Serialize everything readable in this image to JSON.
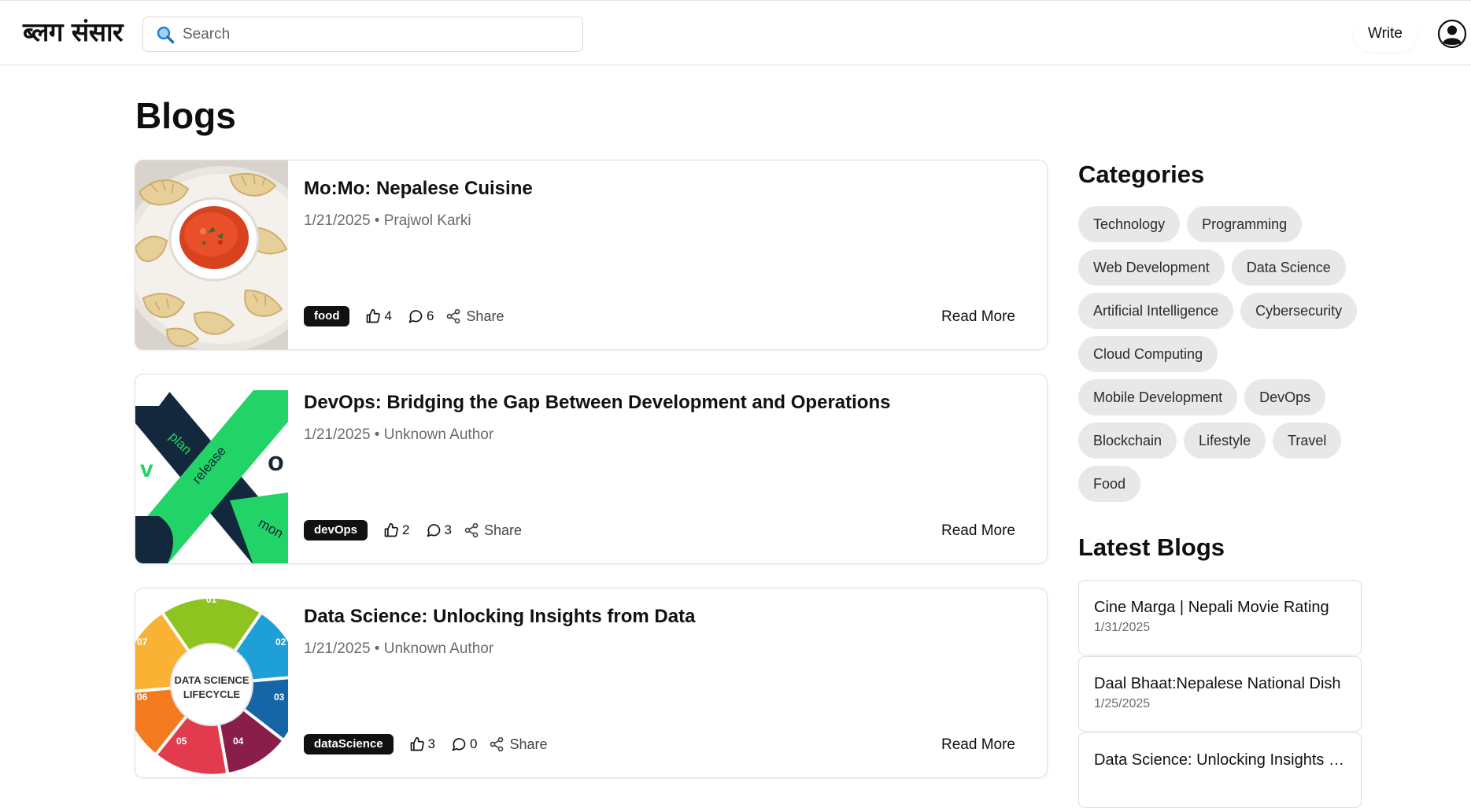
{
  "header": {
    "logo": "ब्लग संसार",
    "search_placeholder": "Search",
    "write_label": "Write"
  },
  "main": {
    "title": "Blogs",
    "posts": [
      {
        "title": "Mo:Mo: Nepalese Cuisine",
        "meta": "1/21/2025 • Prajwol Karki",
        "tag": "food",
        "likes": "4",
        "comments": "6",
        "share_label": "Share",
        "read_more": "Read More"
      },
      {
        "title": "DevOps: Bridging the Gap Between Development and Operations",
        "meta": "1/21/2025 • Unknown Author",
        "tag": "devOps",
        "likes": "2",
        "comments": "3",
        "share_label": "Share",
        "read_more": "Read More",
        "image_text": {
          "left": "v",
          "plan": "plan",
          "release": "release",
          "right": "o",
          "mon": "mon"
        }
      },
      {
        "title": "Data Science: Unlocking Insights from Data",
        "meta": "1/21/2025 • Unknown Author",
        "tag": "dataScience",
        "likes": "3",
        "comments": "0",
        "share_label": "Share",
        "read_more": "Read More",
        "image_text": {
          "center_line1": "DATA SCIENCE",
          "center_line2": "LIFECYCLE",
          "n01": "01",
          "n02": "02",
          "n03": "03",
          "n04": "04",
          "n05": "05",
          "n06": "06",
          "n07": "07"
        }
      }
    ]
  },
  "sidebar": {
    "categories_heading": "Categories",
    "categories": [
      "Technology",
      "Programming",
      "Web Development",
      "Data Science",
      "Artificial Intelligence",
      "Cybersecurity",
      "Cloud Computing",
      "Mobile Development",
      "DevOps",
      "Blockchain",
      "Lifestyle",
      "Travel",
      "Food"
    ],
    "latest_heading": "Latest Blogs",
    "latest": [
      {
        "title": "Cine Marga | Nepali Movie Rating",
        "date": "1/31/2025"
      },
      {
        "title": "Daal Bhaat:Nepalese National Dish",
        "date": "1/25/2025"
      },
      {
        "title": "Data Science: Unlocking Insights from Data",
        "date": ""
      }
    ]
  },
  "colors": {
    "tag_bg": "#111111",
    "chip_bg": "#e8e8e9",
    "devops_green": "#22d367",
    "devops_navy": "#13283d"
  },
  "icons": [
    "search-icon",
    "user-avatar-icon",
    "thumbs-up-icon",
    "comment-icon",
    "share-icon"
  ]
}
